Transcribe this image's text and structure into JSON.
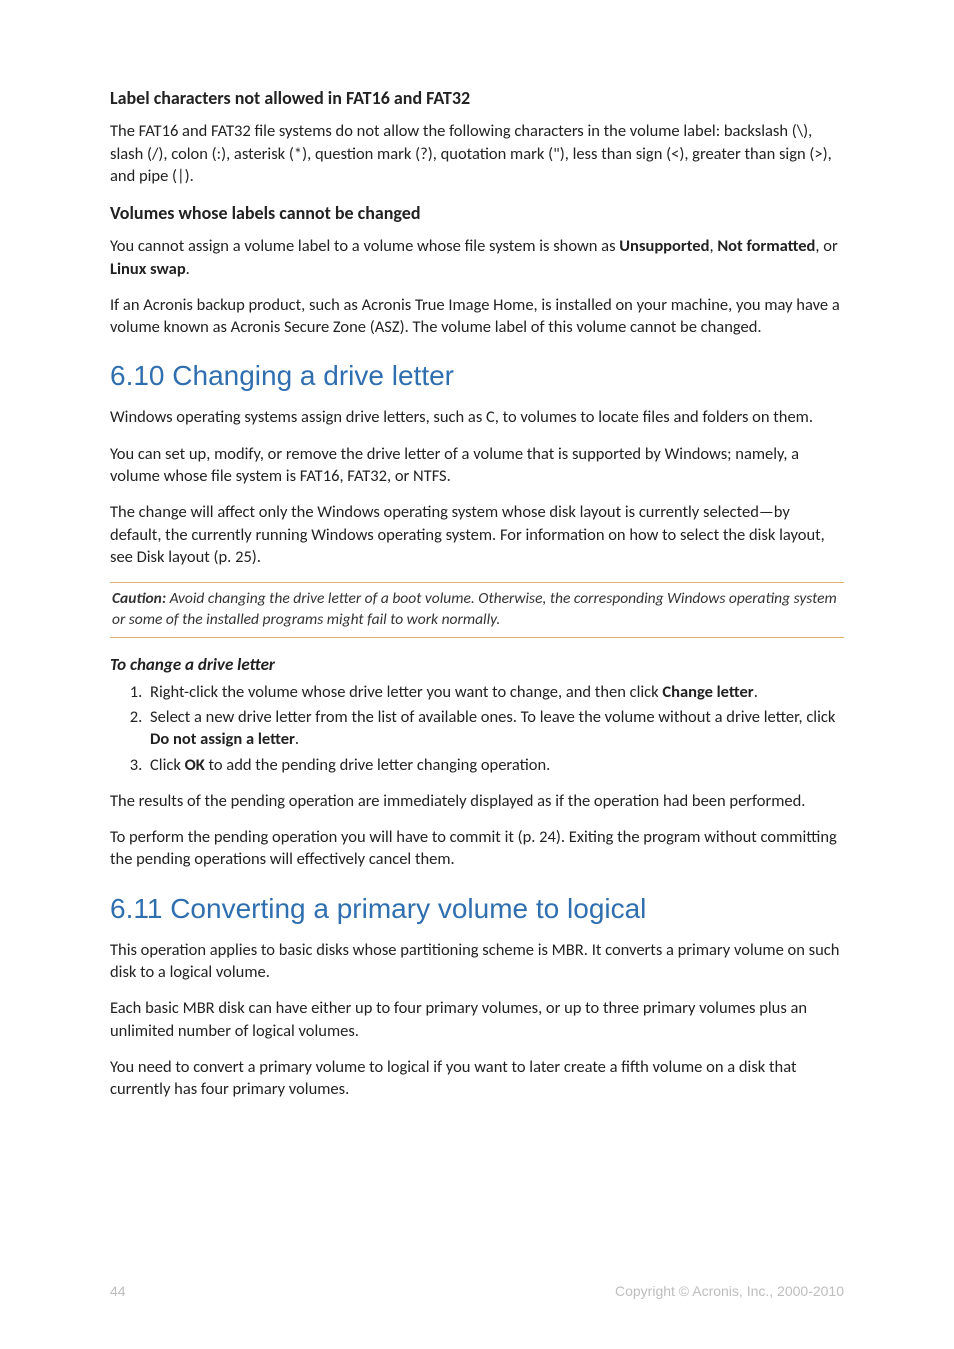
{
  "section_a": {
    "heading": "Label characters not allowed in FAT16 and FAT32",
    "p1": "The FAT16 and FAT32 file systems do not allow the following characters in the volume label: backslash (\\), slash (/), colon (:), asterisk (*), question mark (?), quotation mark (\"), less than sign (<), greater than sign (>), and pipe (|)."
  },
  "section_b": {
    "heading": "Volumes whose labels cannot be changed",
    "p1_pre": "You cannot assign a volume label to a volume whose file system is shown as ",
    "p1_b1": "Unsupported",
    "p1_mid1": ", ",
    "p1_b2": "Not formatted",
    "p1_mid2": ", or ",
    "p1_b3": "Linux swap",
    "p1_end": ".",
    "p2": "If an Acronis backup product, such as Acronis True Image Home, is installed on your machine, you may have a volume known as Acronis Secure Zone (ASZ). The volume label of this volume cannot be changed."
  },
  "section_610": {
    "heading": "6.10  Changing a drive letter",
    "p1": "Windows operating systems assign drive letters, such as C, to volumes to locate files and folders on them.",
    "p2": "You can set up, modify, or remove the drive letter of a volume that is supported by Windows; namely, a volume whose file system is FAT16, FAT32, or NTFS.",
    "p3": "The change will affect only the Windows operating system whose disk layout is currently selected—by default, the currently running Windows operating system. For information on how to select the disk layout, see Disk layout (p. 25).",
    "callout_lead": "Caution:",
    "callout_body": " Avoid changing the drive letter of a boot volume. Otherwise, the corresponding Windows operating system or some of the installed programs might fail to work normally.",
    "h4": "To change a drive letter",
    "li1_pre": "Right-click the volume whose drive letter you want to change, and then click ",
    "li1_b": "Change letter",
    "li1_end": ".",
    "li2_pre": "Select a new drive letter from the list of available ones. To leave the volume without a drive letter, click ",
    "li2_b": "Do not assign a letter",
    "li2_end": ".",
    "li3_pre": "Click ",
    "li3_b": "OK",
    "li3_end": " to add the pending drive letter changing operation.",
    "p4": "The results of the pending operation are immediately displayed as if the operation had been performed.",
    "p5": "To perform the pending operation you will have to commit it (p. 24). Exiting the program without committing the pending operations will effectively cancel them."
  },
  "section_611": {
    "heading": "6.11  Converting a primary volume to logical",
    "p1": "This operation applies to basic disks whose partitioning scheme is MBR. It converts a primary volume on such disk to a logical volume.",
    "p2": "Each basic MBR disk can have either up to four primary volumes, or up to three primary volumes plus an unlimited number of logical volumes.",
    "p3": "You need to convert a primary volume to logical if you want to later create a fifth volume on a disk that currently has four primary volumes."
  },
  "footer": {
    "page": "44",
    "copyright": "Copyright © Acronis, Inc., 2000-2010"
  }
}
